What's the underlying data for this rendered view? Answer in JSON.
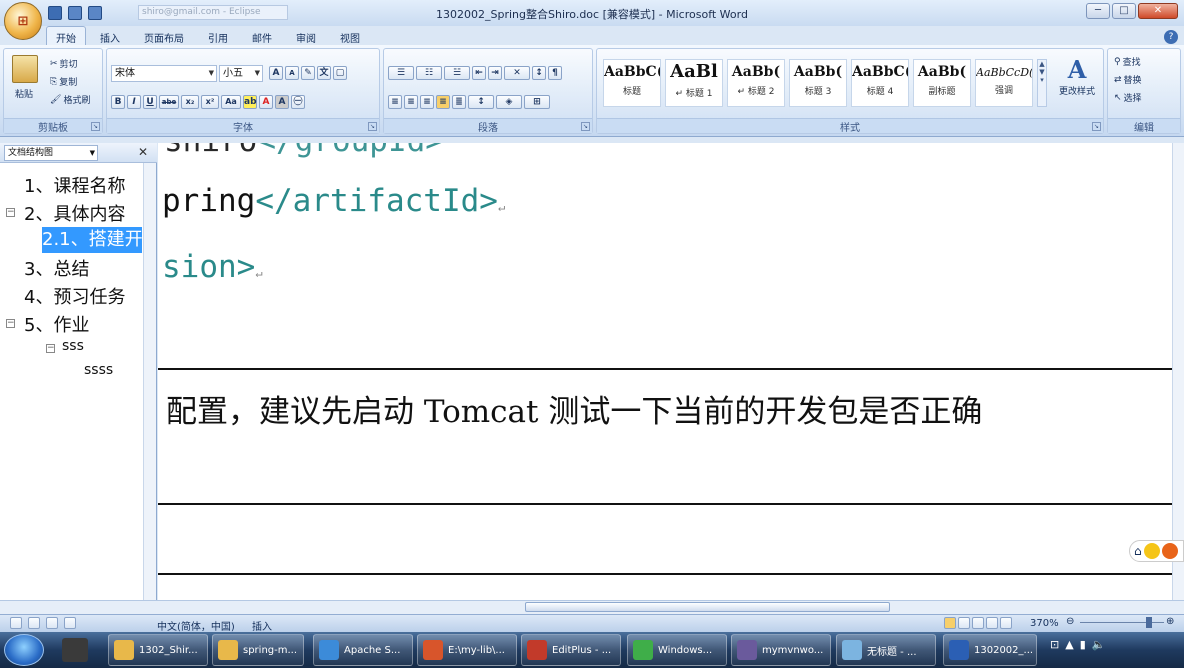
{
  "window": {
    "title": "1302002_Spring整合Shiro.doc [兼容模式] - Microsoft Word",
    "qat_search": "shiro@gmail.com - Eclipse",
    "controls": [
      "─",
      "□",
      "✕"
    ]
  },
  "tabs": [
    "开始",
    "插入",
    "页面布局",
    "引用",
    "邮件",
    "审阅",
    "视图"
  ],
  "ribbon": {
    "clipboard": {
      "label": "剪贴板",
      "paste": "粘贴",
      "cut": "剪切",
      "copy": "复制",
      "format_painter": "格式刷"
    },
    "font": {
      "label": "字体",
      "font_name": "宋体",
      "font_size": "小五",
      "grow": "A",
      "shrink": "A",
      "bold": "B",
      "italic": "I",
      "underline": "U",
      "strike": "abe",
      "sub": "x₂",
      "sup": "x²",
      "case": "Aa"
    },
    "paragraph": {
      "label": "段落"
    },
    "styles": {
      "label": "样式",
      "items": [
        {
          "preview": "AaBbC(",
          "name": "标题"
        },
        {
          "preview": "AaBl",
          "name": "↵ 标题 1"
        },
        {
          "preview": "AaBb(",
          "name": "↵ 标题 2"
        },
        {
          "preview": "AaBb(",
          "name": "标题 3"
        },
        {
          "preview": "AaBbC(",
          "name": "标题 4"
        },
        {
          "preview": "AaBb(",
          "name": "副标题"
        },
        {
          "preview": "AaBbCcD(",
          "name": "强调"
        }
      ],
      "change_styles": "更改样式"
    },
    "editing": {
      "label": "编辑",
      "find": "查找",
      "replace": "替换",
      "select": "选择"
    }
  },
  "nav": {
    "view": "文档结构图",
    "items": [
      {
        "text": "1、课程名称"
      },
      {
        "text": "2、具体内容"
      },
      {
        "text": "2.1、搭建开"
      },
      {
        "text": "3、总结"
      },
      {
        "text": "4、预习任务"
      },
      {
        "text": "5、作业"
      },
      {
        "text": "sss"
      },
      {
        "text": "ssss"
      }
    ]
  },
  "document": {
    "line1_tag": "</groupId>",
    "line1_prefix": "shiro",
    "line2_text": "pring",
    "line2_tag": "</artifactId>",
    "line3_text": "sion>",
    "body": "配置，建议先启动 Tomcat 测试一下当前的开发包是否正确"
  },
  "status": {
    "language": "中文(简体，中国)",
    "mode": "插入",
    "zoom": "370%"
  },
  "taskbar": {
    "items": [
      {
        "label": "1302_Shir...",
        "color": "#e8b84a"
      },
      {
        "label": "spring-m...",
        "color": "#e8b84a"
      },
      {
        "label": "Apache S...",
        "color": "#3c8bd9"
      },
      {
        "label": "E:\\my-lib\\...",
        "color": "#d8552b"
      },
      {
        "label": "EditPlus - ...",
        "color": "#c23a2a"
      },
      {
        "label": "Windows...",
        "color": "#3fae49"
      },
      {
        "label": "mymvnwo...",
        "color": "#6a5a9c"
      },
      {
        "label": "无标题 - ...",
        "color": "#7cb4e0"
      },
      {
        "label": "1302002_...",
        "color": "#2b5fb4"
      }
    ]
  }
}
